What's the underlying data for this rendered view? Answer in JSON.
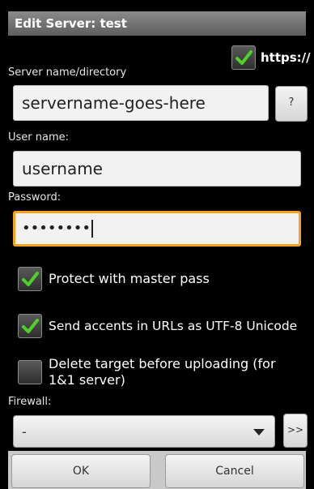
{
  "dialog": {
    "title": "Edit Server: test"
  },
  "server": {
    "https_label": "https://",
    "https_checked": true,
    "name_label": "Server name/directory",
    "name_value": "servername-goes-here",
    "help_button": "?"
  },
  "user": {
    "label": "User name:",
    "value": "username"
  },
  "password": {
    "label": "Password:",
    "masked_value": "••••••••"
  },
  "options": {
    "protect_label": "Protect with master pass",
    "protect_checked": true,
    "accents_label": "Send accents in URLs as UTF-8 Unicode",
    "accents_checked": true,
    "delete_label": "Delete target before uploading (for 1&1 server)",
    "delete_checked": false
  },
  "firewall": {
    "label": "Firewall:",
    "selected": "-",
    "more_button": ">>"
  },
  "actions": {
    "ok_label": "OK",
    "cancel_label": "Cancel"
  },
  "colors": {
    "focus": "#f7a21b",
    "check": "#4fd12b"
  }
}
